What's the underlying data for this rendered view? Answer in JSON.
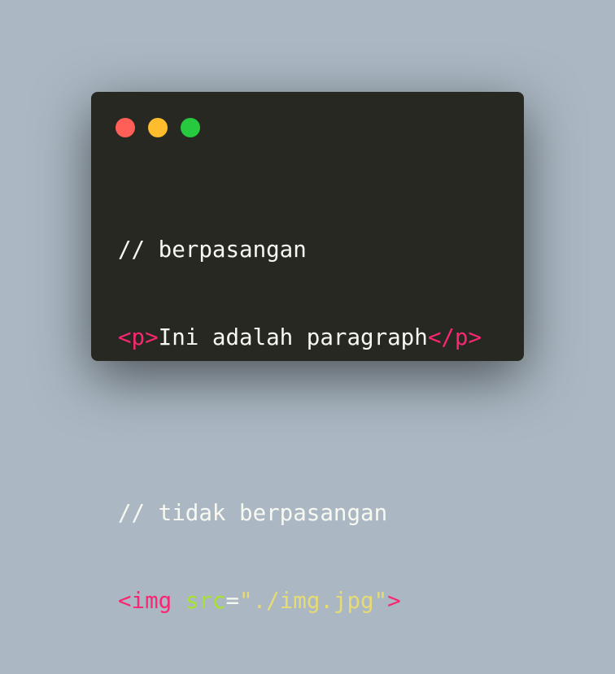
{
  "window_controls": {
    "close_color": "#ff5f56",
    "minimize_color": "#ffbd2e",
    "maximize_color": "#27c93f"
  },
  "code": {
    "line1": "// berpasangan",
    "line2": {
      "open_tag": "<p>",
      "text": "Ini adalah paragraph",
      "close_tag": "</p>"
    },
    "line4": "// tidak berpasangan",
    "line5": {
      "tag_open": "<img",
      "attr_name": "src",
      "equals": "=",
      "attr_value": "\"./img.jpg\"",
      "tag_close": ">"
    }
  }
}
